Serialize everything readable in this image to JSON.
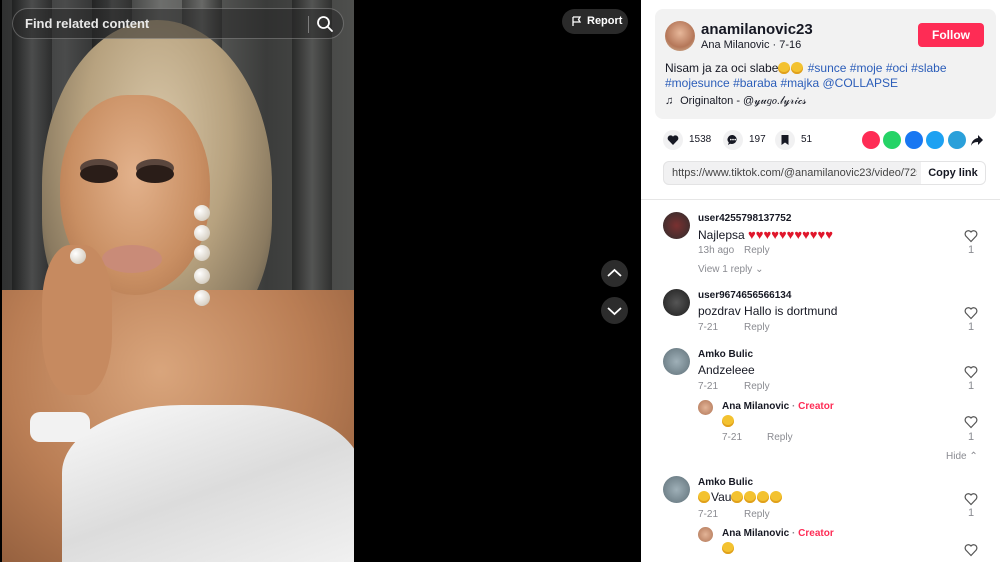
{
  "search": {
    "placeholder": "Find related content"
  },
  "report": {
    "label": "Report",
    "icon": "flag-icon"
  },
  "nav": {
    "up_icon": "chevron-up-icon",
    "down_icon": "chevron-down-icon"
  },
  "author": {
    "username": "anamilanovic23",
    "nickname": "Ana Milanovic",
    "date": "7-16",
    "follow_label": "Follow"
  },
  "caption": {
    "text": "Nisam ja za oci slabe",
    "tags": [
      "#sunce",
      "#moje",
      "#oci",
      "#slabe",
      "#mojesunce",
      "#baraba",
      "#majka",
      "@COLLAPSE"
    ]
  },
  "music": {
    "title": "Originalton - ",
    "author": "@𝓎𝓊𝑔𝑜.𝓁𝓎𝓇𝒾𝒸𝓈"
  },
  "stats": {
    "likes": "1538",
    "comments": "197",
    "saves": "51"
  },
  "share_icons": [
    {
      "name": "repost-icon",
      "color": "#fe2c55"
    },
    {
      "name": "whatsapp-icon",
      "color": "#25d366"
    },
    {
      "name": "facebook-icon",
      "color": "#1877f2"
    },
    {
      "name": "twitter-icon",
      "color": "#1da1f2"
    },
    {
      "name": "telegram-icon",
      "color": "#2aa0da"
    }
  ],
  "link": {
    "url": "https://www.tiktok.com/@anamilanovic23/video/7256...",
    "copy_label": "Copy link"
  },
  "comments": [
    {
      "user": "user4255798137752",
      "text": "Najlepsa",
      "hearts": 11,
      "time": "13h ago",
      "reply": "Reply",
      "likes": "1",
      "view_replies": "View 1 reply"
    },
    {
      "user": "user9674656566134",
      "text": "pozdrav Hallo is dortmund",
      "time": "7-21",
      "reply": "Reply",
      "likes": "1"
    },
    {
      "user": "Amko Bulic",
      "text": "Andzeleee",
      "time": "7-21",
      "reply": "Reply",
      "likes": "1"
    },
    {
      "user": "Ana Milanovic",
      "creator_label": "Creator",
      "time": "7-21",
      "reply": "Reply",
      "likes": "1",
      "hide": "Hide"
    },
    {
      "user": "Amko Bulic",
      "text": "Vau",
      "time": "7-21",
      "reply": "Reply",
      "likes": "1"
    },
    {
      "user": "Ana Milanovic",
      "creator_label": "Creator"
    }
  ],
  "colors": {
    "accent": "#fe2c55",
    "tag": "#2b5db9",
    "muted": "#8a8b91"
  }
}
